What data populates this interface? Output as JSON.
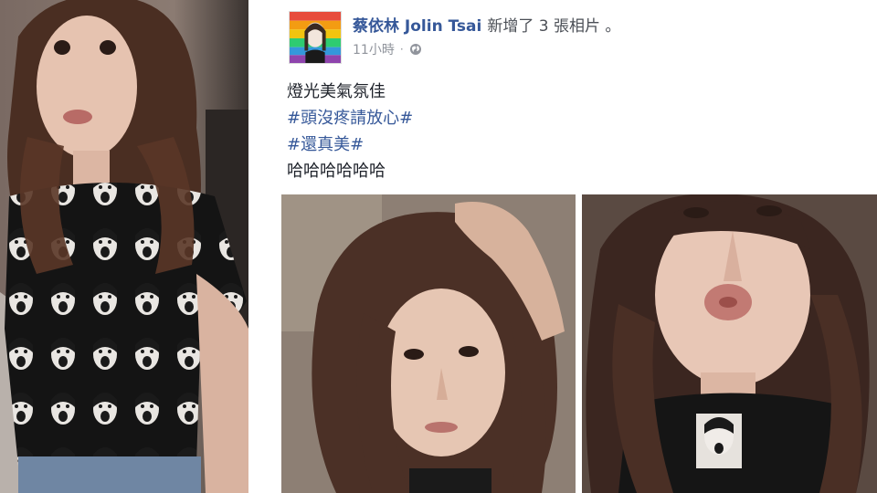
{
  "post": {
    "author_name": "蔡依林 Jolin Tsai",
    "action_text": "新增了 3 張相片 。",
    "timestamp": "11小時",
    "separator": "·",
    "privacy_icon": "globe-icon",
    "status_lines": [
      {
        "text": "燈光美氣氛佳",
        "type": "text"
      },
      {
        "text": "#頭沒疼請放心#",
        "type": "hashtag"
      },
      {
        "text": "#還真美#",
        "type": "hashtag"
      },
      {
        "text": "哈哈哈哈哈哈",
        "type": "text"
      }
    ]
  },
  "colors": {
    "link": "#365899",
    "meta": "#90949c",
    "text": "#1d2129"
  }
}
